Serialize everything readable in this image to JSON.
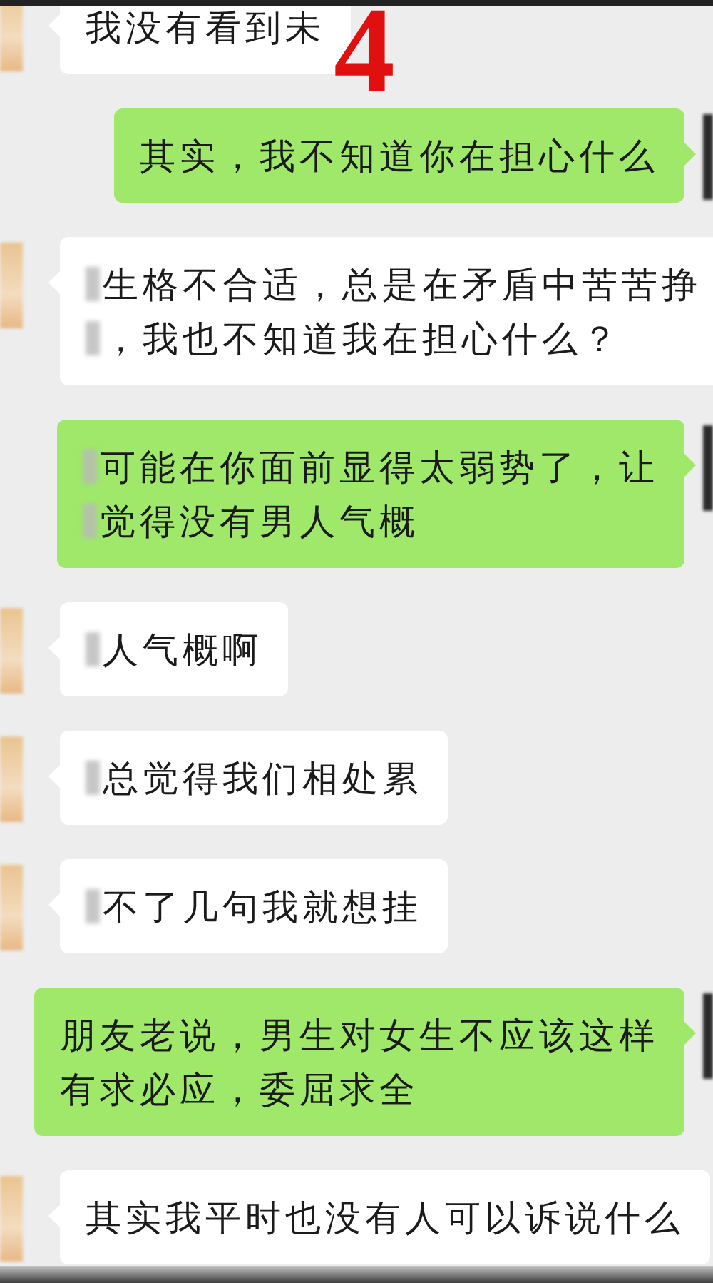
{
  "overlay_number": "4",
  "messages": [
    {
      "kind": "received",
      "lines": [
        {
          "text": "我没有看到未",
          "redacted": false
        }
      ]
    },
    {
      "kind": "sent",
      "lines": [
        {
          "text": "其实，我不知道你在担心什么",
          "redacted": false
        }
      ]
    },
    {
      "kind": "received",
      "lines": [
        {
          "text": "生格不合适，总是在矛盾中苦苦挣",
          "redacted": true
        },
        {
          "text": "，我也不知道我在担心什么？",
          "redacted": true
        }
      ]
    },
    {
      "kind": "sent",
      "lines": [
        {
          "text": "可能在你面前显得太弱势了，让",
          "redacted": true
        },
        {
          "text": "觉得没有男人气概",
          "redacted": true
        }
      ]
    },
    {
      "kind": "received",
      "lines": [
        {
          "text": "人气概啊",
          "redacted": true
        }
      ]
    },
    {
      "kind": "received",
      "lines": [
        {
          "text": "总觉得我们相处累",
          "redacted": true
        }
      ]
    },
    {
      "kind": "received",
      "lines": [
        {
          "text": "不了几句我就想挂",
          "redacted": true
        }
      ]
    },
    {
      "kind": "sent",
      "lines": [
        {
          "text": "朋友老说，男生对女生不应该这样",
          "redacted": false
        },
        {
          "text": "有求必应，委屈求全",
          "redacted": false
        }
      ]
    },
    {
      "kind": "received",
      "lines": [
        {
          "text": "其实我平时也没有人可以诉说什么",
          "redacted": false
        }
      ]
    }
  ]
}
